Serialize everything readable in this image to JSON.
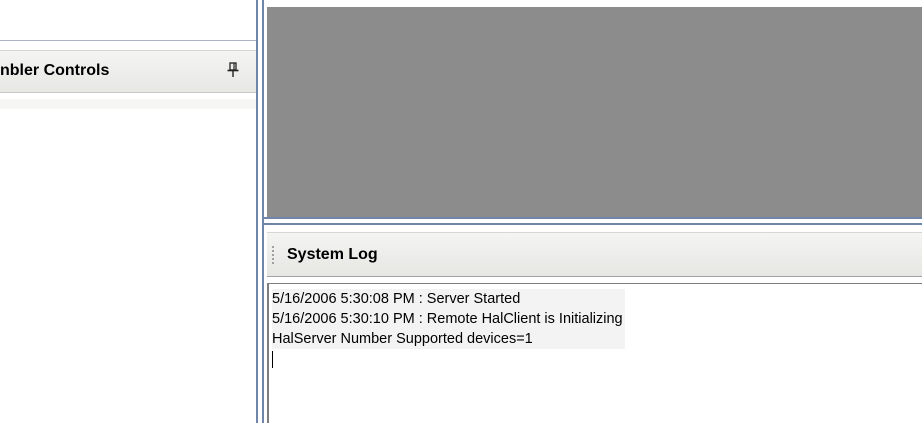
{
  "left_panel": {
    "title": "nbler Controls",
    "pin_icon": "pin-icon"
  },
  "system_log": {
    "title": "System Log",
    "grip_icon": "grip-icon",
    "lines": [
      "5/16/2006 5:30:08 PM : Server Started",
      "5/16/2006 5:30:10 PM : Remote HalClient is Initializing",
      "HalServer Number Supported devices=1"
    ]
  },
  "colors": {
    "splitter": "#6f86a8",
    "canvas": "#8c8c8c",
    "header_bg": "#eeefec"
  }
}
